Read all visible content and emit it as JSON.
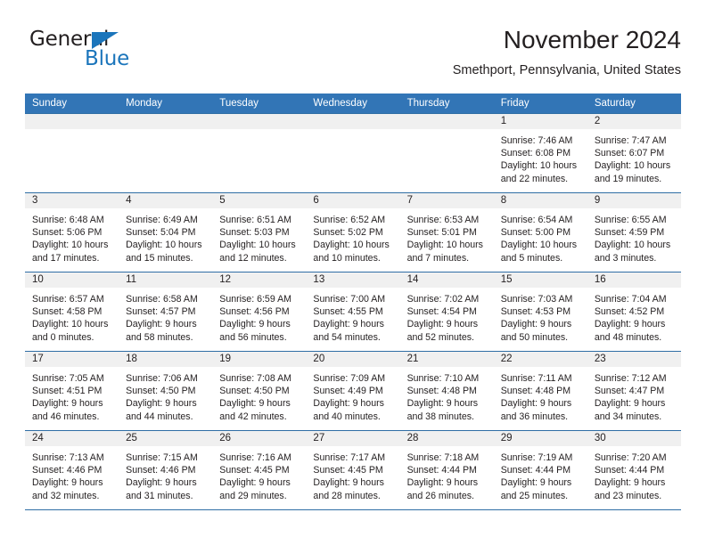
{
  "brand": {
    "name_part1": "General",
    "name_part2": "Blue",
    "triangle_color": "#1b75bb"
  },
  "header": {
    "title": "November 2024",
    "location": "Smethport, Pennsylvania, United States"
  },
  "colors": {
    "header_blue": "#3275b6",
    "grid_line": "#2f6ea5",
    "daynum_band": "#f0f0f0",
    "text": "#231f20"
  },
  "calendar": {
    "weekday_headers": [
      "Sunday",
      "Monday",
      "Tuesday",
      "Wednesday",
      "Thursday",
      "Friday",
      "Saturday"
    ],
    "weeks": [
      [
        {
          "empty": true
        },
        {
          "empty": true
        },
        {
          "empty": true
        },
        {
          "empty": true
        },
        {
          "empty": true
        },
        {
          "day": "1",
          "sunrise": "Sunrise: 7:46 AM",
          "sunset": "Sunset: 6:08 PM",
          "daylight_line1": "Daylight: 10 hours",
          "daylight_line2": "and 22 minutes."
        },
        {
          "day": "2",
          "sunrise": "Sunrise: 7:47 AM",
          "sunset": "Sunset: 6:07 PM",
          "daylight_line1": "Daylight: 10 hours",
          "daylight_line2": "and 19 minutes."
        }
      ],
      [
        {
          "day": "3",
          "sunrise": "Sunrise: 6:48 AM",
          "sunset": "Sunset: 5:06 PM",
          "daylight_line1": "Daylight: 10 hours",
          "daylight_line2": "and 17 minutes."
        },
        {
          "day": "4",
          "sunrise": "Sunrise: 6:49 AM",
          "sunset": "Sunset: 5:04 PM",
          "daylight_line1": "Daylight: 10 hours",
          "daylight_line2": "and 15 minutes."
        },
        {
          "day": "5",
          "sunrise": "Sunrise: 6:51 AM",
          "sunset": "Sunset: 5:03 PM",
          "daylight_line1": "Daylight: 10 hours",
          "daylight_line2": "and 12 minutes."
        },
        {
          "day": "6",
          "sunrise": "Sunrise: 6:52 AM",
          "sunset": "Sunset: 5:02 PM",
          "daylight_line1": "Daylight: 10 hours",
          "daylight_line2": "and 10 minutes."
        },
        {
          "day": "7",
          "sunrise": "Sunrise: 6:53 AM",
          "sunset": "Sunset: 5:01 PM",
          "daylight_line1": "Daylight: 10 hours",
          "daylight_line2": "and 7 minutes."
        },
        {
          "day": "8",
          "sunrise": "Sunrise: 6:54 AM",
          "sunset": "Sunset: 5:00 PM",
          "daylight_line1": "Daylight: 10 hours",
          "daylight_line2": "and 5 minutes."
        },
        {
          "day": "9",
          "sunrise": "Sunrise: 6:55 AM",
          "sunset": "Sunset: 4:59 PM",
          "daylight_line1": "Daylight: 10 hours",
          "daylight_line2": "and 3 minutes."
        }
      ],
      [
        {
          "day": "10",
          "sunrise": "Sunrise: 6:57 AM",
          "sunset": "Sunset: 4:58 PM",
          "daylight_line1": "Daylight: 10 hours",
          "daylight_line2": "and 0 minutes."
        },
        {
          "day": "11",
          "sunrise": "Sunrise: 6:58 AM",
          "sunset": "Sunset: 4:57 PM",
          "daylight_line1": "Daylight: 9 hours",
          "daylight_line2": "and 58 minutes."
        },
        {
          "day": "12",
          "sunrise": "Sunrise: 6:59 AM",
          "sunset": "Sunset: 4:56 PM",
          "daylight_line1": "Daylight: 9 hours",
          "daylight_line2": "and 56 minutes."
        },
        {
          "day": "13",
          "sunrise": "Sunrise: 7:00 AM",
          "sunset": "Sunset: 4:55 PM",
          "daylight_line1": "Daylight: 9 hours",
          "daylight_line2": "and 54 minutes."
        },
        {
          "day": "14",
          "sunrise": "Sunrise: 7:02 AM",
          "sunset": "Sunset: 4:54 PM",
          "daylight_line1": "Daylight: 9 hours",
          "daylight_line2": "and 52 minutes."
        },
        {
          "day": "15",
          "sunrise": "Sunrise: 7:03 AM",
          "sunset": "Sunset: 4:53 PM",
          "daylight_line1": "Daylight: 9 hours",
          "daylight_line2": "and 50 minutes."
        },
        {
          "day": "16",
          "sunrise": "Sunrise: 7:04 AM",
          "sunset": "Sunset: 4:52 PM",
          "daylight_line1": "Daylight: 9 hours",
          "daylight_line2": "and 48 minutes."
        }
      ],
      [
        {
          "day": "17",
          "sunrise": "Sunrise: 7:05 AM",
          "sunset": "Sunset: 4:51 PM",
          "daylight_line1": "Daylight: 9 hours",
          "daylight_line2": "and 46 minutes."
        },
        {
          "day": "18",
          "sunrise": "Sunrise: 7:06 AM",
          "sunset": "Sunset: 4:50 PM",
          "daylight_line1": "Daylight: 9 hours",
          "daylight_line2": "and 44 minutes."
        },
        {
          "day": "19",
          "sunrise": "Sunrise: 7:08 AM",
          "sunset": "Sunset: 4:50 PM",
          "daylight_line1": "Daylight: 9 hours",
          "daylight_line2": "and 42 minutes."
        },
        {
          "day": "20",
          "sunrise": "Sunrise: 7:09 AM",
          "sunset": "Sunset: 4:49 PM",
          "daylight_line1": "Daylight: 9 hours",
          "daylight_line2": "and 40 minutes."
        },
        {
          "day": "21",
          "sunrise": "Sunrise: 7:10 AM",
          "sunset": "Sunset: 4:48 PM",
          "daylight_line1": "Daylight: 9 hours",
          "daylight_line2": "and 38 minutes."
        },
        {
          "day": "22",
          "sunrise": "Sunrise: 7:11 AM",
          "sunset": "Sunset: 4:48 PM",
          "daylight_line1": "Daylight: 9 hours",
          "daylight_line2": "and 36 minutes."
        },
        {
          "day": "23",
          "sunrise": "Sunrise: 7:12 AM",
          "sunset": "Sunset: 4:47 PM",
          "daylight_line1": "Daylight: 9 hours",
          "daylight_line2": "and 34 minutes."
        }
      ],
      [
        {
          "day": "24",
          "sunrise": "Sunrise: 7:13 AM",
          "sunset": "Sunset: 4:46 PM",
          "daylight_line1": "Daylight: 9 hours",
          "daylight_line2": "and 32 minutes."
        },
        {
          "day": "25",
          "sunrise": "Sunrise: 7:15 AM",
          "sunset": "Sunset: 4:46 PM",
          "daylight_line1": "Daylight: 9 hours",
          "daylight_line2": "and 31 minutes."
        },
        {
          "day": "26",
          "sunrise": "Sunrise: 7:16 AM",
          "sunset": "Sunset: 4:45 PM",
          "daylight_line1": "Daylight: 9 hours",
          "daylight_line2": "and 29 minutes."
        },
        {
          "day": "27",
          "sunrise": "Sunrise: 7:17 AM",
          "sunset": "Sunset: 4:45 PM",
          "daylight_line1": "Daylight: 9 hours",
          "daylight_line2": "and 28 minutes."
        },
        {
          "day": "28",
          "sunrise": "Sunrise: 7:18 AM",
          "sunset": "Sunset: 4:44 PM",
          "daylight_line1": "Daylight: 9 hours",
          "daylight_line2": "and 26 minutes."
        },
        {
          "day": "29",
          "sunrise": "Sunrise: 7:19 AM",
          "sunset": "Sunset: 4:44 PM",
          "daylight_line1": "Daylight: 9 hours",
          "daylight_line2": "and 25 minutes."
        },
        {
          "day": "30",
          "sunrise": "Sunrise: 7:20 AM",
          "sunset": "Sunset: 4:44 PM",
          "daylight_line1": "Daylight: 9 hours",
          "daylight_line2": "and 23 minutes."
        }
      ]
    ]
  }
}
